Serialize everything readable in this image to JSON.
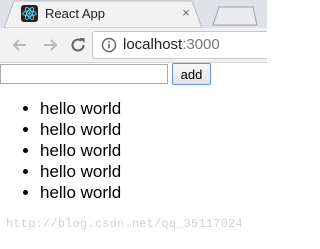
{
  "browser": {
    "tab": {
      "title": "React App",
      "close_glyph": "×",
      "favicon": "react-logo-icon"
    },
    "address_bar": {
      "host": "localhost",
      "port": ":3000"
    }
  },
  "app": {
    "input": {
      "value": "",
      "placeholder": ""
    },
    "add_label": "add",
    "items": [
      "hello world",
      "hello world",
      "hello world",
      "hello world",
      "hello world"
    ]
  },
  "watermark": "http://blog.csdn.net/qq_35117024",
  "colors": {
    "tabstrip": "#dfe3e8",
    "toolbar": "#f2f2f2",
    "react_blue": "#61dafb",
    "button_border": "#6b8fd6"
  }
}
